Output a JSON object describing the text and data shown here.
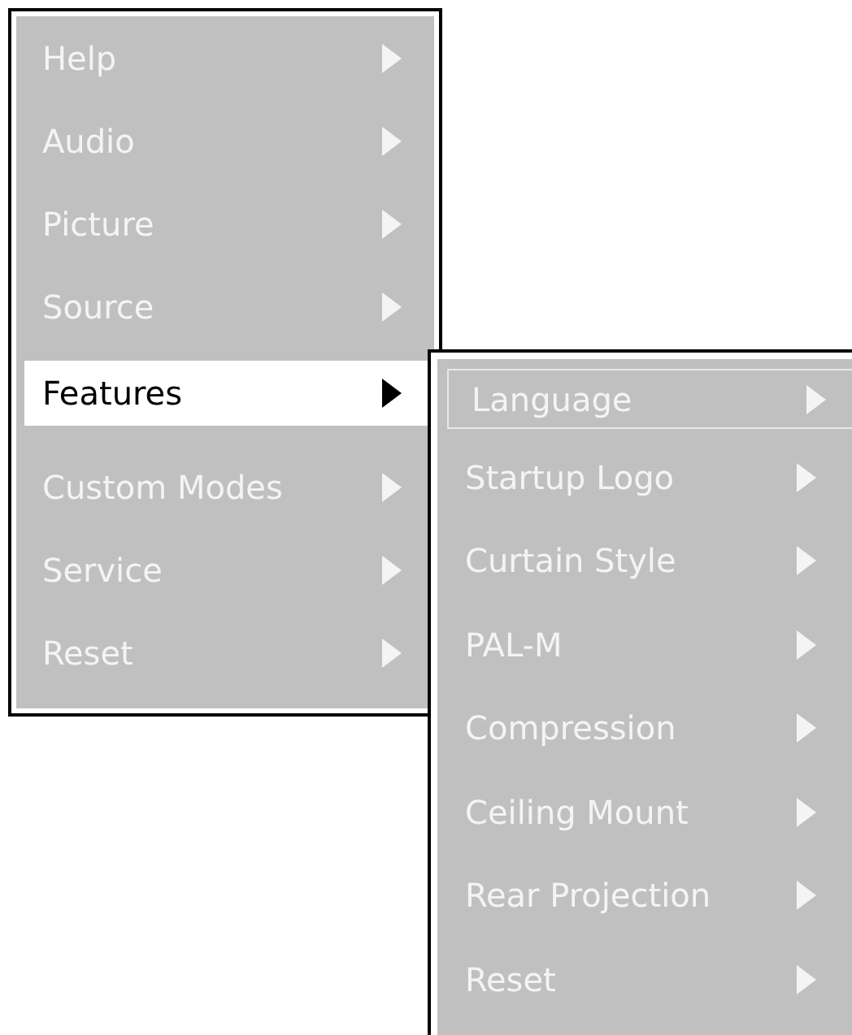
{
  "menu": {
    "items": [
      {
        "label": "Help",
        "selected": false
      },
      {
        "label": "Audio",
        "selected": false
      },
      {
        "label": "Picture",
        "selected": false
      },
      {
        "label": "Source",
        "selected": false
      },
      {
        "label": "Features",
        "selected": true
      },
      {
        "label": "Custom Modes",
        "selected": false
      },
      {
        "label": "Service",
        "selected": false
      },
      {
        "label": "Reset",
        "selected": false
      }
    ]
  },
  "submenu": {
    "items": [
      {
        "label": "Language",
        "selected": true
      },
      {
        "label": "Startup Logo",
        "selected": false
      },
      {
        "label": "Curtain Style",
        "selected": false
      },
      {
        "label": "PAL-M",
        "selected": false
      },
      {
        "label": "Compression",
        "selected": false
      },
      {
        "label": "Ceiling Mount",
        "selected": false
      },
      {
        "label": "Rear Projection",
        "selected": false
      },
      {
        "label": "Reset",
        "selected": false
      }
    ]
  }
}
